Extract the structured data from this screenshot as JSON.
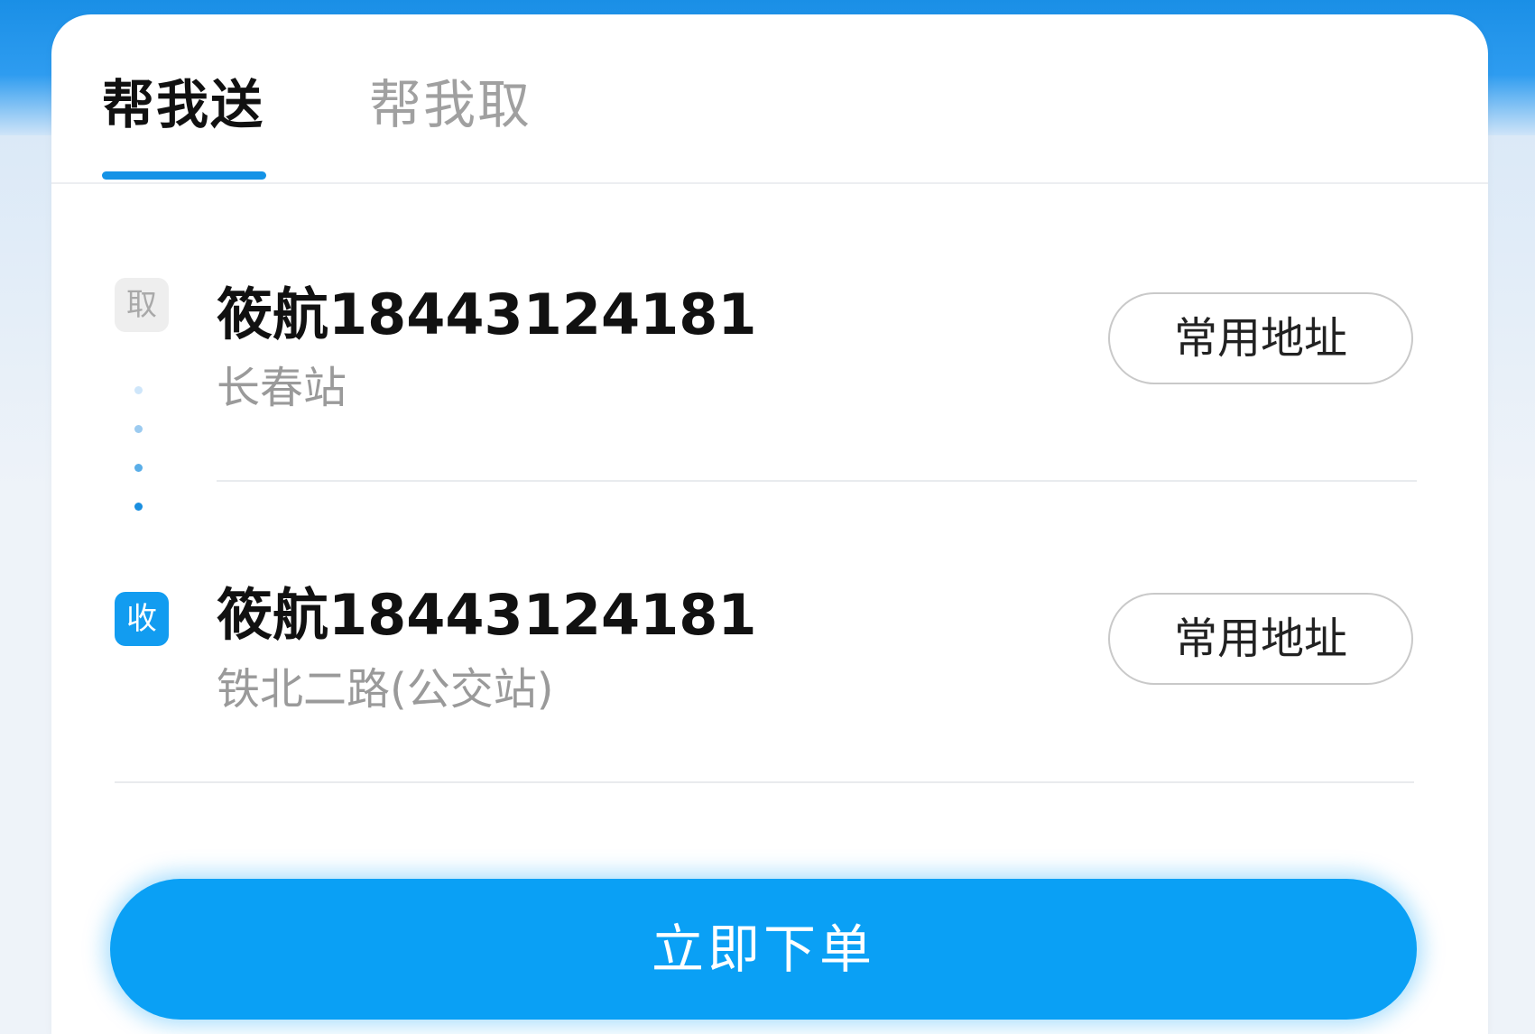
{
  "tabs": [
    {
      "label": "帮我送",
      "active": true
    },
    {
      "label": "帮我取",
      "active": false
    }
  ],
  "pickup": {
    "badge": "取",
    "contact": "筱航18443124181",
    "address": "长春站",
    "common_button": "常用地址"
  },
  "delivery": {
    "badge": "收",
    "contact": "筱航18443124181",
    "address": "铁北二路(公交站)",
    "common_button": "常用地址"
  },
  "order_button": "立即下单",
  "colors": {
    "accent": "#1593e6",
    "button_blue": "#0aa0f5",
    "receive_badge": "#129cf0"
  }
}
